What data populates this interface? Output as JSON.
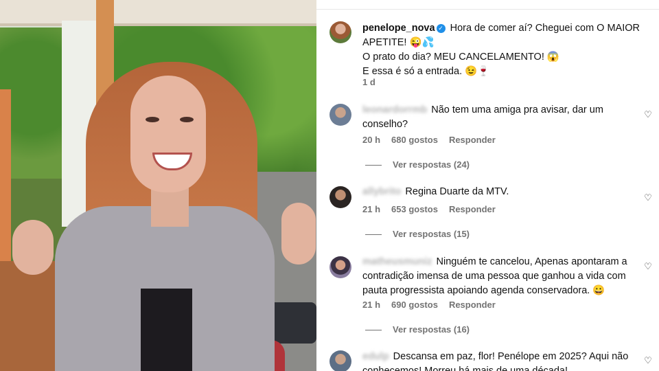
{
  "post": {
    "username": "penelope_nova",
    "verified_mark": "✓",
    "caption_line1": "Hora de comer aí? Cheguei com O MAIOR APETITE! 😜💦",
    "caption_line2": "O prato do dia? MEU CANCELAMENTO! 😱",
    "caption_line3": "E essa é só a entrada. 😉🍷",
    "time": "1 d"
  },
  "comments": [
    {
      "username": "leonardorrmb",
      "text": "Não tem uma amiga pra avisar, dar um conselho?",
      "time": "20 h",
      "likes": "680 gostos",
      "reply": "Responder",
      "replies": "Ver respostas (24)"
    },
    {
      "username": "allybrito",
      "text": "Regina Duarte da MTV.",
      "time": "21 h",
      "likes": "653 gostos",
      "reply": "Responder",
      "replies": "Ver respostas (15)"
    },
    {
      "username": "matheusmuniz",
      "text": "Ninguém te cancelou, Apenas apontaram a contradição imensa de uma pessoa que ganhou a vida com pauta progressista apoiando agenda conservadora. 😀",
      "time": "21 h",
      "likes": "690 gostos",
      "reply": "Responder",
      "replies": "Ver respostas (16)"
    },
    {
      "username": "edulp",
      "text": "Descansa em paz, flor! Penélope em 2025? Aqui não conhecemos! Morreu há mais de uma década!"
    }
  ],
  "icons": {
    "heart": "heart-outline-icon",
    "verified": "verified-badge-icon"
  },
  "colors": {
    "verified": "#1f8fe8",
    "meta_text": "#737373"
  }
}
